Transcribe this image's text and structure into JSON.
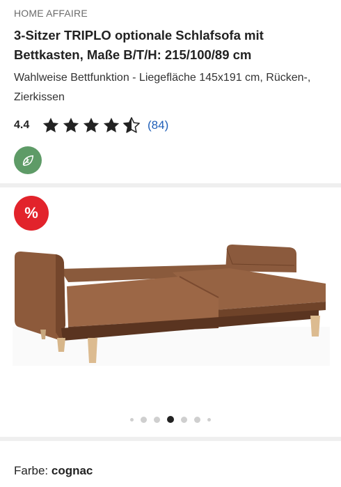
{
  "product": {
    "brand": "HOME AFFAIRE",
    "title": "3-Sitzer TRIPLO optionale Schlafsofa mit Bettkasten, Maße B/T/H: 215/100/89 cm",
    "subtitle": "Wahlweise Bettfunktion - Liegefläche 145x191 cm, Rücken-, Zierkissen"
  },
  "rating": {
    "value": "4.4",
    "stars_filled": 4.4,
    "stars_total": 5,
    "review_count": "(84)",
    "star_color": "#222222"
  },
  "eco_badge": {
    "icon": "leaf-icon",
    "color": "#5e9b67"
  },
  "gallery": {
    "sale_badge": "%",
    "sale_color": "#e2232b",
    "image_description_icon": "sofa-bed-image",
    "dots_total": 7,
    "active_dot_index": 3
  },
  "color_selector": {
    "label": "Farbe:",
    "value": "cognac"
  }
}
